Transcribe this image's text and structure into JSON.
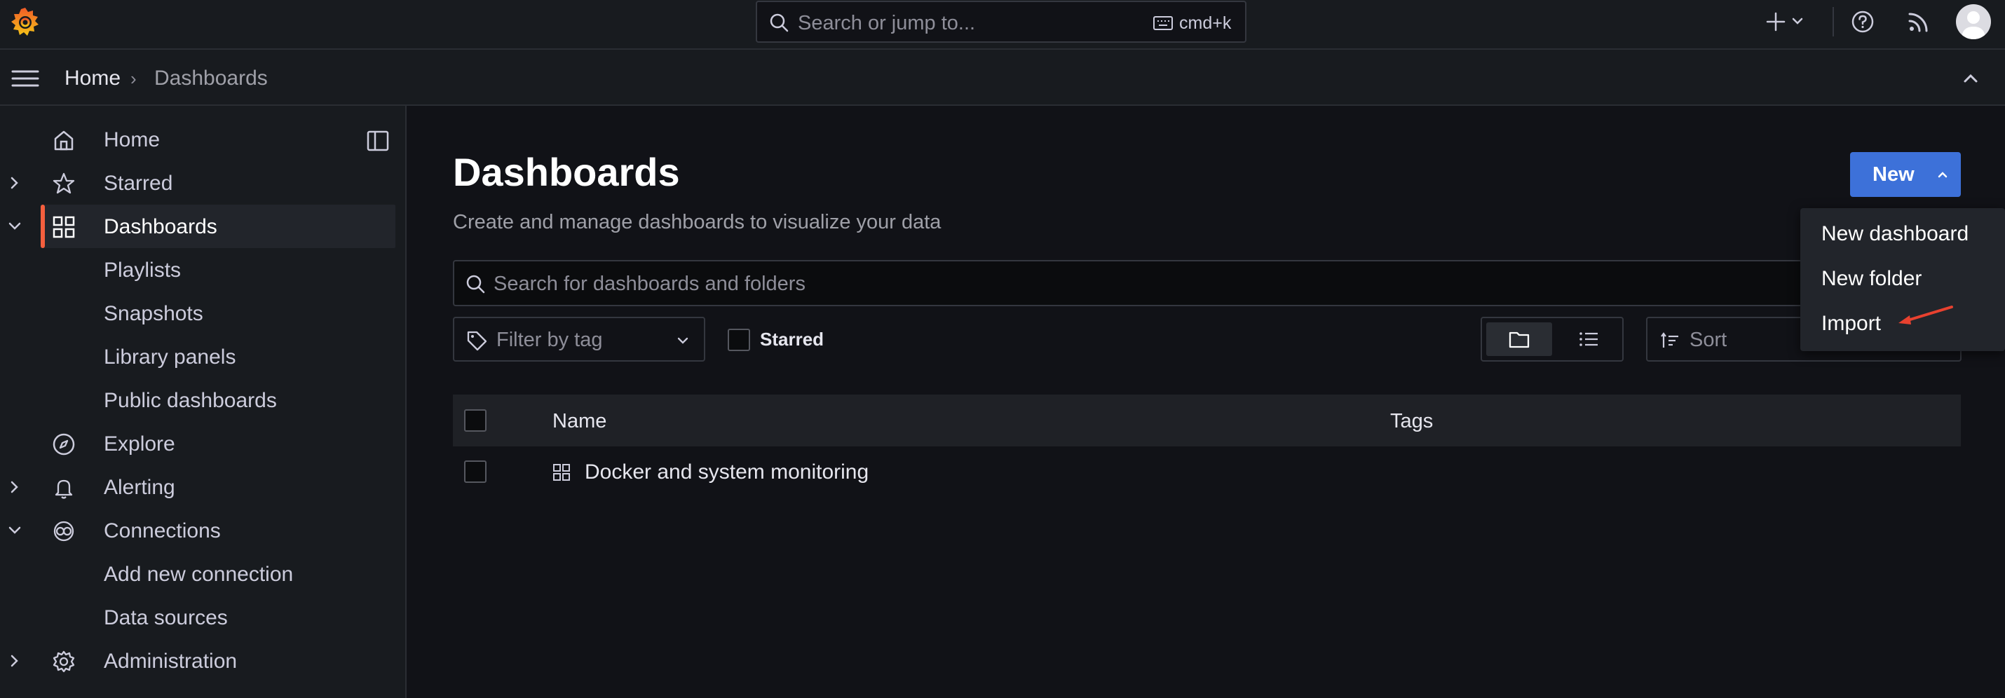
{
  "topbar": {
    "search_placeholder": "Search or jump to...",
    "search_shortcut": "cmd+k",
    "icons": [
      "grafana-logo-icon",
      "search-icon",
      "keyboard-icon",
      "plus-icon",
      "chevron-down-icon",
      "help-icon",
      "rss-icon",
      "user-avatar"
    ]
  },
  "breadcrumb": {
    "home": "Home",
    "separator": "›",
    "current": "Dashboards"
  },
  "sidebar": {
    "items": [
      {
        "label": "Home",
        "icon": "home-icon",
        "expandable": false
      },
      {
        "label": "Starred",
        "icon": "star-icon",
        "expandable": true,
        "expanded": false
      },
      {
        "label": "Dashboards",
        "icon": "apps-icon",
        "expandable": true,
        "expanded": true,
        "active": true
      },
      {
        "label": "Playlists",
        "sub": true
      },
      {
        "label": "Snapshots",
        "sub": true
      },
      {
        "label": "Library panels",
        "sub": true
      },
      {
        "label": "Public dashboards",
        "sub": true
      },
      {
        "label": "Explore",
        "icon": "compass-icon",
        "expandable": false
      },
      {
        "label": "Alerting",
        "icon": "bell-icon",
        "expandable": true,
        "expanded": false
      },
      {
        "label": "Connections",
        "icon": "connections-icon",
        "expandable": true,
        "expanded": true
      },
      {
        "label": "Add new connection",
        "sub": true
      },
      {
        "label": "Data sources",
        "sub": true
      },
      {
        "label": "Administration",
        "icon": "gear-icon",
        "expandable": true,
        "expanded": false
      }
    ]
  },
  "main": {
    "title": "Dashboards",
    "subtitle": "Create and manage dashboards to visualize your data",
    "new_button": "New",
    "search_placeholder": "Search for dashboards and folders",
    "tag_filter_placeholder": "Filter by tag",
    "starred_label": "Starred",
    "sort_placeholder": "Sort",
    "table": {
      "columns": [
        "Name",
        "Tags"
      ],
      "rows": [
        {
          "name": "Docker and system monitoring",
          "tags": ""
        }
      ]
    },
    "new_menu": {
      "items": [
        "New dashboard",
        "New folder",
        "Import"
      ]
    }
  },
  "colors": {
    "accent_blue": "#3d71d9",
    "active_bar": "#f55f3e",
    "annotation_arrow": "#e8412f",
    "background": "#111217",
    "panel": "#181b1f"
  }
}
